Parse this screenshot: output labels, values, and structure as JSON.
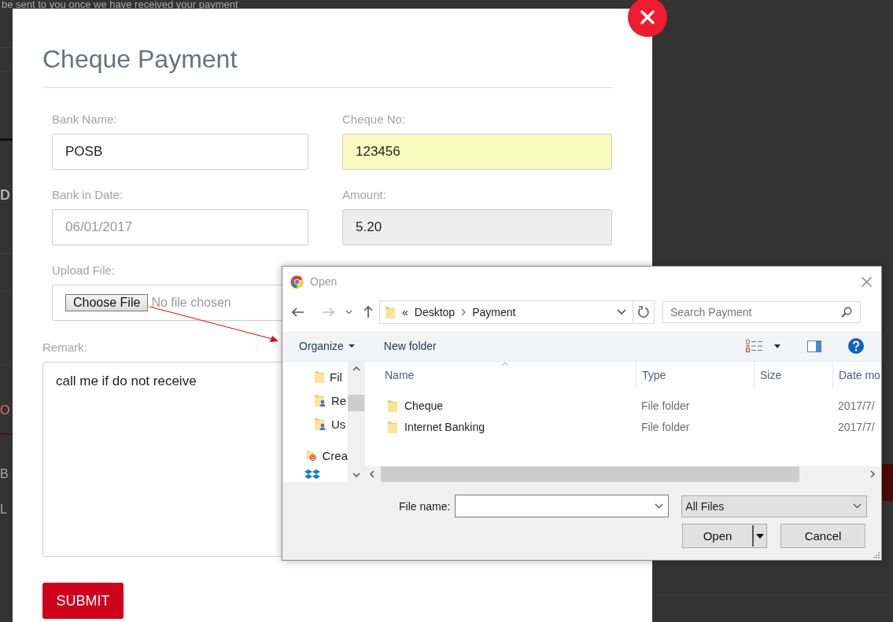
{
  "background_page": {
    "notice": "be sent to you once we have received your payment",
    "fragments": [
      {
        "text": "D",
        "kind": "heading"
      },
      {
        "text": "O",
        "kind": "tab"
      },
      {
        "text": "B",
        "kind": "text"
      },
      {
        "text": "L",
        "kind": "text"
      }
    ]
  },
  "modal": {
    "title": "Cheque Payment",
    "fields": [
      {
        "label": "Bank Name:",
        "kind": "text",
        "value": "POSB",
        "highlighted": false,
        "disabled": false
      },
      {
        "label": "Cheque No:",
        "kind": "text",
        "value": "123456",
        "highlighted": true,
        "disabled": false
      },
      {
        "label": "Bank in Date:",
        "kind": "text",
        "placeholder": "06/01/2017",
        "highlighted": false,
        "disabled": false
      },
      {
        "label": "Amount:",
        "kind": "text",
        "value": "5.20",
        "highlighted": false,
        "disabled": true
      },
      {
        "label": "Upload File:",
        "kind": "file",
        "button": "Choose File",
        "status": "No file chosen"
      }
    ],
    "remark": {
      "label": "Remark:",
      "value": "call me if do not receive"
    },
    "submit": "SUBMIT"
  },
  "file_dialog": {
    "title": "Open",
    "address": {
      "overflow": "«",
      "path": [
        "Desktop",
        "Payment"
      ]
    },
    "search": {
      "placeholder": "Search Payment"
    },
    "toolbar": {
      "organize": "Organize",
      "new_folder": "New folder"
    },
    "nav_items": [
      {
        "text": "Fil",
        "kind": "folder"
      },
      {
        "text": "Re",
        "kind": "user-folder"
      },
      {
        "text": "Us",
        "kind": "user-folder"
      },
      {
        "text": "Crea",
        "kind": "cloud-folder"
      },
      {
        "kind": "dropbox"
      }
    ],
    "columns": [
      "Name",
      "Type",
      "Size",
      "Date mo"
    ],
    "files": [
      {
        "name": "Cheque",
        "type": "File folder",
        "date": "2017/7/"
      },
      {
        "name": "Internet Banking",
        "type": "File folder",
        "date": "2017/7/"
      }
    ],
    "file_name": {
      "label": "File name:"
    },
    "filter": "All Files",
    "buttons": [
      "Open",
      "Cancel"
    ]
  }
}
